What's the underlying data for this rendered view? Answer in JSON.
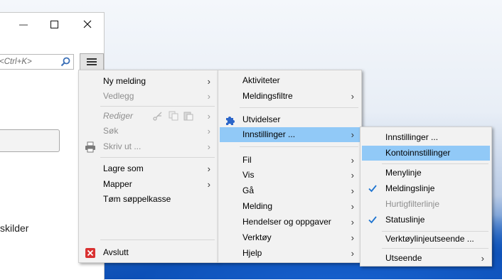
{
  "window": {
    "minimize_glyph": "—",
    "maximize_glyph": "☐",
    "close_glyph": "✕"
  },
  "search": {
    "placeholder": "<Ctrl+K>"
  },
  "content": {
    "partial_text": "skilder"
  },
  "menu_main": {
    "items": [
      {
        "label": "Ny melding",
        "disabled": false,
        "submenu": true
      },
      {
        "label": "Vedlegg",
        "disabled": true,
        "submenu": true
      },
      {
        "label": "Rediger",
        "disabled": true,
        "submenu": true
      },
      {
        "label": "Søk",
        "disabled": true,
        "submenu": true
      },
      {
        "label": "Skriv ut ...",
        "disabled": true,
        "submenu": true
      },
      {
        "label": "Lagre som",
        "disabled": false,
        "submenu": true
      },
      {
        "label": "Mapper",
        "disabled": false,
        "submenu": true
      },
      {
        "label": "Tøm søppelkasse",
        "disabled": false,
        "submenu": false
      },
      {
        "label": "Avslutt",
        "disabled": false,
        "submenu": false
      }
    ]
  },
  "menu_tools": {
    "items": [
      {
        "label": "Aktiviteter",
        "submenu": false
      },
      {
        "label": "Meldingsfiltre",
        "submenu": true
      },
      {
        "label": "Utvidelser",
        "submenu": false
      },
      {
        "label": "Innstillinger ...",
        "submenu": true,
        "active": true
      },
      {
        "label": "Fil",
        "submenu": true
      },
      {
        "label": "Vis",
        "submenu": true
      },
      {
        "label": "Gå",
        "submenu": true
      },
      {
        "label": "Melding",
        "submenu": true
      },
      {
        "label": "Hendelser og oppgaver",
        "submenu": true
      },
      {
        "label": "Verktøy",
        "submenu": true
      },
      {
        "label": "Hjelp",
        "submenu": true
      }
    ]
  },
  "menu_settings": {
    "items": [
      {
        "label": "Innstillinger ...",
        "checked": false
      },
      {
        "label": "Kontoinnstillinger",
        "checked": false,
        "active": true
      },
      {
        "label": "Menylinje",
        "checked": false
      },
      {
        "label": "Meldingslinje",
        "checked": true
      },
      {
        "label": "Hurtigfilterlinje",
        "checked": false,
        "disabled": true
      },
      {
        "label": "Statuslinje",
        "checked": true
      },
      {
        "label": "Verktøylinjeutseende ...",
        "checked": false
      },
      {
        "label": "Utseende",
        "checked": false,
        "submenu": true
      }
    ]
  },
  "colors": {
    "highlight": "#91c9f7",
    "check": "#1e74d0",
    "close_icon_bg": "#d93232"
  }
}
